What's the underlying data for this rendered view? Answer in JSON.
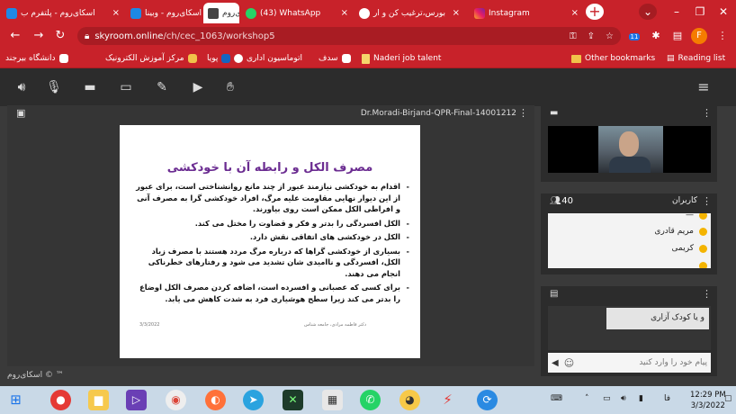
{
  "browser": {
    "tabs": [
      {
        "label": "اسکای‌روم - پلتفرم ب",
        "active": false
      },
      {
        "label": "اسکای‌روم - وبینا",
        "active": false
      },
      {
        "label": "اسکای‌روم",
        "active": true
      },
      {
        "label": "(43) WhatsApp",
        "active": false
      },
      {
        "label": "بورس،ترغیب کن و ار",
        "active": false
      },
      {
        "label": "Instagram",
        "active": false
      }
    ],
    "url_host": "skyroom.online",
    "url_path": "/ch/cec_1063/workshop5",
    "profile_initial": "F",
    "extension_badge": "11",
    "bookmarks": [
      "دانشگاه بیرجند",
      "مرکز آموزش الکترونیک",
      "پویا",
      "اتوماسیون اداری",
      "سدف",
      "Naderi job talent",
      "Other bookmarks",
      "Reading list"
    ]
  },
  "stage": {
    "title": "Dr.Moradi-Birjand-QPR-Final-14001212",
    "slide_title": "مصرف الکل و رابطه آن با خودکشی",
    "bullets": [
      "اقدام به خودکشی نیازمند عبور از چند مانع روانشناختی است، برای عبور از این دیوار نهایی مقاومت علیه مرگ، افراد خودکشی گرا به مصرف آنی و افراطی الکل ممکن است روی بیاورند.",
      "الکل افسردگی را بدتر و فکر و قضاوت را مختل می کند.",
      "الکل در خودکشی های اتفاقی نقش دارد.",
      "بسیاری از خودکشی گراها که درباره مرگ مردد هستند با مصرف زیاد الکل، افسردگی و ناامیدی شان تشدید می شود و رفتارهای خطرناکی انجام می دهند.",
      "برای کسی که عصبانی و افسرده است، اضافه کردن مصرف الکل اوضاع را بدتر می کند زیرا سطح هوشیاری فرد به شدت کاهش می یابد."
    ],
    "slide_footer_left": "3/3/2022",
    "slide_footer_right": "دکتر فاطمه مرادی، جامعه شناس"
  },
  "brand": "اسکای‌روم © ™",
  "users_panel": {
    "label": "کاربران",
    "count": "40",
    "users": [
      "مریم قادری",
      "کریمی"
    ]
  },
  "chat": {
    "message": "و یا کودک آزاری",
    "placeholder": "پیام خود را وارد کنید"
  },
  "taskbar": {
    "time": "12:29 PM",
    "date": "3/3/2022",
    "language": "فا"
  }
}
